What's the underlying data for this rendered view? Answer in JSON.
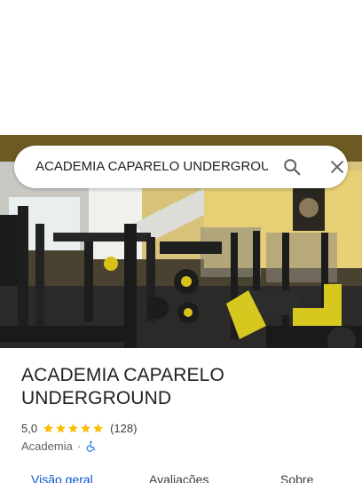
{
  "search": {
    "query": "ACADEMIA CAPARELO UNDERGROUND",
    "search_icon": "search-icon",
    "close_icon": "close-icon"
  },
  "place": {
    "name_line1": "ACADEMIA CAPARELO",
    "name_line2": "UNDERGROUND",
    "rating": "5,0",
    "stars": 5,
    "reviews": "(128)",
    "category": "Academia",
    "separator": "·",
    "accessibility_icon": "wheelchair-icon"
  },
  "tabs": [
    {
      "label": "Visão geral",
      "active": true
    },
    {
      "label": "Avaliações",
      "active": false
    },
    {
      "label": "Sobre",
      "active": false
    }
  ],
  "colors": {
    "star": "#fbbc04",
    "active_tab": "#0b57d0",
    "accessibility": "#1a73e8"
  }
}
